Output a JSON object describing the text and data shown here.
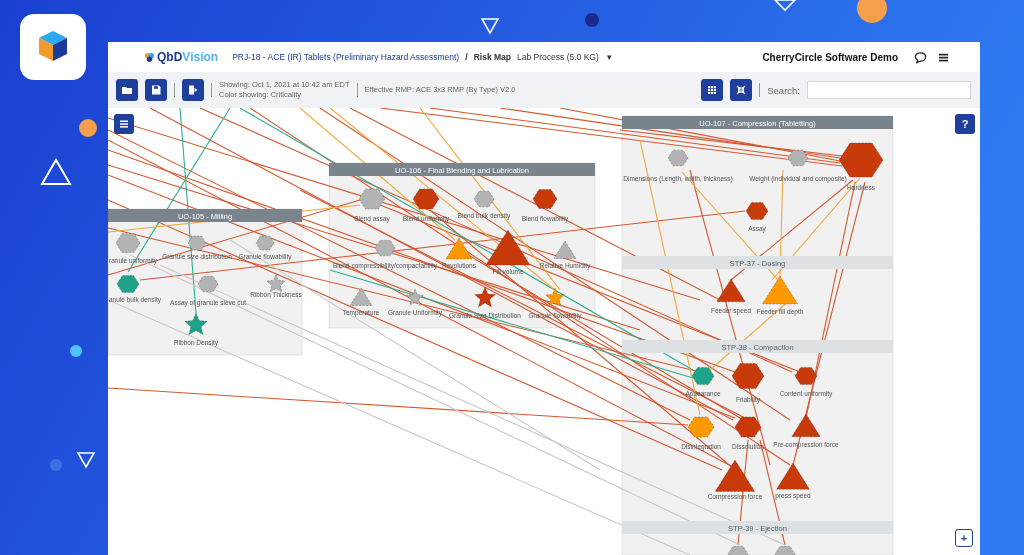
{
  "logo_parts": [
    "QbD",
    "Vision"
  ],
  "breadcrumb": {
    "project": "PRJ-18 - ACE (IR) Tablets (Preliminary Hazard Assessment)",
    "separator": "/",
    "page": "Risk Map",
    "process": "Lab Process (5.0 KG)",
    "caret": "▾"
  },
  "user": "CherryCircle Software Demo",
  "toolbar": {
    "showing": "Showing: Oct 1, 2021 at 10:42 am EDT",
    "color_showing": "Color showing: Criticality",
    "effective_rmp": "Effective RMP: ACE 3x3 RMP (By Type) V2.0",
    "search_label": "Search:"
  },
  "canvas_buttons": {
    "help": "?",
    "zoom_in": "+"
  },
  "lanes": [
    {
      "title": "UO-105 - Milling",
      "nodes": [
        {
          "label": "ranule uniformity",
          "kind": "hexagon",
          "color": "#b3b3b3"
        },
        {
          "label": "Granule size distribution",
          "kind": "hexagon",
          "color": "#b3b3b3"
        },
        {
          "label": "Granule flowability",
          "kind": "hexagon",
          "color": "#b3b3b3"
        },
        {
          "label": "anule bulk density",
          "kind": "hexagon",
          "color": "#1fa287"
        },
        {
          "label": "Assay of granule sieve cut",
          "kind": "hexagon",
          "color": "#b3b3b3"
        },
        {
          "label": "Ribbon Thickness",
          "kind": "star",
          "color": "#b3b3b3"
        },
        {
          "label": "Ribbon Density",
          "kind": "star",
          "color": "#1fa287"
        }
      ]
    },
    {
      "title": "UO-106 - Final Blending and Lubrication",
      "nodes": [
        {
          "label": "Blend assay",
          "kind": "hexagon",
          "color": "#b3b3b3"
        },
        {
          "label": "Blend uniformity",
          "kind": "hexagon",
          "color": "#c83a0a"
        },
        {
          "label": "Blend bulk density",
          "kind": "hexagon",
          "color": "#b3b3b3"
        },
        {
          "label": "Blend flowability",
          "kind": "hexagon",
          "color": "#c83a0a"
        },
        {
          "label": "Blend compressibility/compactability",
          "kind": "hexagon",
          "color": "#b3b3b3"
        },
        {
          "label": "Revolutions",
          "kind": "triangle",
          "color": "#ff9900"
        },
        {
          "label": "Fill volume",
          "kind": "triangle",
          "color": "#c83a0a"
        },
        {
          "label": "Relative Humidity",
          "kind": "triangle",
          "color": "#b3b3b3"
        },
        {
          "label": "Temperature",
          "kind": "triangle",
          "color": "#b3b3b3"
        },
        {
          "label": "Granule Uniformity",
          "kind": "star",
          "color": "#b3b3b3"
        },
        {
          "label": "Granule Size Distribution",
          "kind": "star",
          "color": "#c83a0a"
        },
        {
          "label": "Granule flowability",
          "kind": "star",
          "color": "#ff9900"
        }
      ]
    },
    {
      "title": "UO-107 - Compression (Tabletting)",
      "nodes": [
        {
          "label": "Dimensions (Length, width, thickness)",
          "kind": "hexagon",
          "color": "#b3b3b3"
        },
        {
          "label": "Weight (individual and composite)",
          "kind": "hexagon",
          "color": "#b3b3b3"
        },
        {
          "label": "Hardness",
          "kind": "hexagon",
          "color": "#c83a0a"
        },
        {
          "label": "Assay",
          "kind": "hexagon",
          "color": "#c83a0a"
        }
      ],
      "steps": [
        {
          "title": "STP-37 - Dosing",
          "nodes": [
            {
              "label": "Feeder speed",
              "kind": "triangle",
              "color": "#c83a0a"
            },
            {
              "label": "Feeder fill depth",
              "kind": "triangle",
              "color": "#ff9900"
            }
          ]
        },
        {
          "title": "STP-38 - Compaction",
          "nodes": [
            {
              "label": "Appearance",
              "kind": "hexagon",
              "color": "#1fa287"
            },
            {
              "label": "Friability",
              "kind": "hexagon",
              "color": "#c83a0a"
            },
            {
              "label": "Content uniformity",
              "kind": "hexagon",
              "color": "#c83a0a"
            },
            {
              "label": "Disintegration",
              "kind": "hexagon",
              "color": "#ff9900"
            },
            {
              "label": "Dissolution",
              "kind": "hexagon",
              "color": "#c83a0a"
            },
            {
              "label": "Pre-compression force",
              "kind": "triangle",
              "color": "#c83a0a"
            },
            {
              "label": "Compression force",
              "kind": "triangle",
              "color": "#c83a0a"
            },
            {
              "label": "press speed",
              "kind": "triangle",
              "color": "#c83a0a"
            }
          ]
        },
        {
          "title": "STP-39 - Ejection",
          "nodes": [
            {
              "kind": "hexagon",
              "color": "#b3b3b3"
            },
            {
              "kind": "hexagon",
              "color": "#b3b3b3"
            }
          ]
        }
      ]
    }
  ]
}
